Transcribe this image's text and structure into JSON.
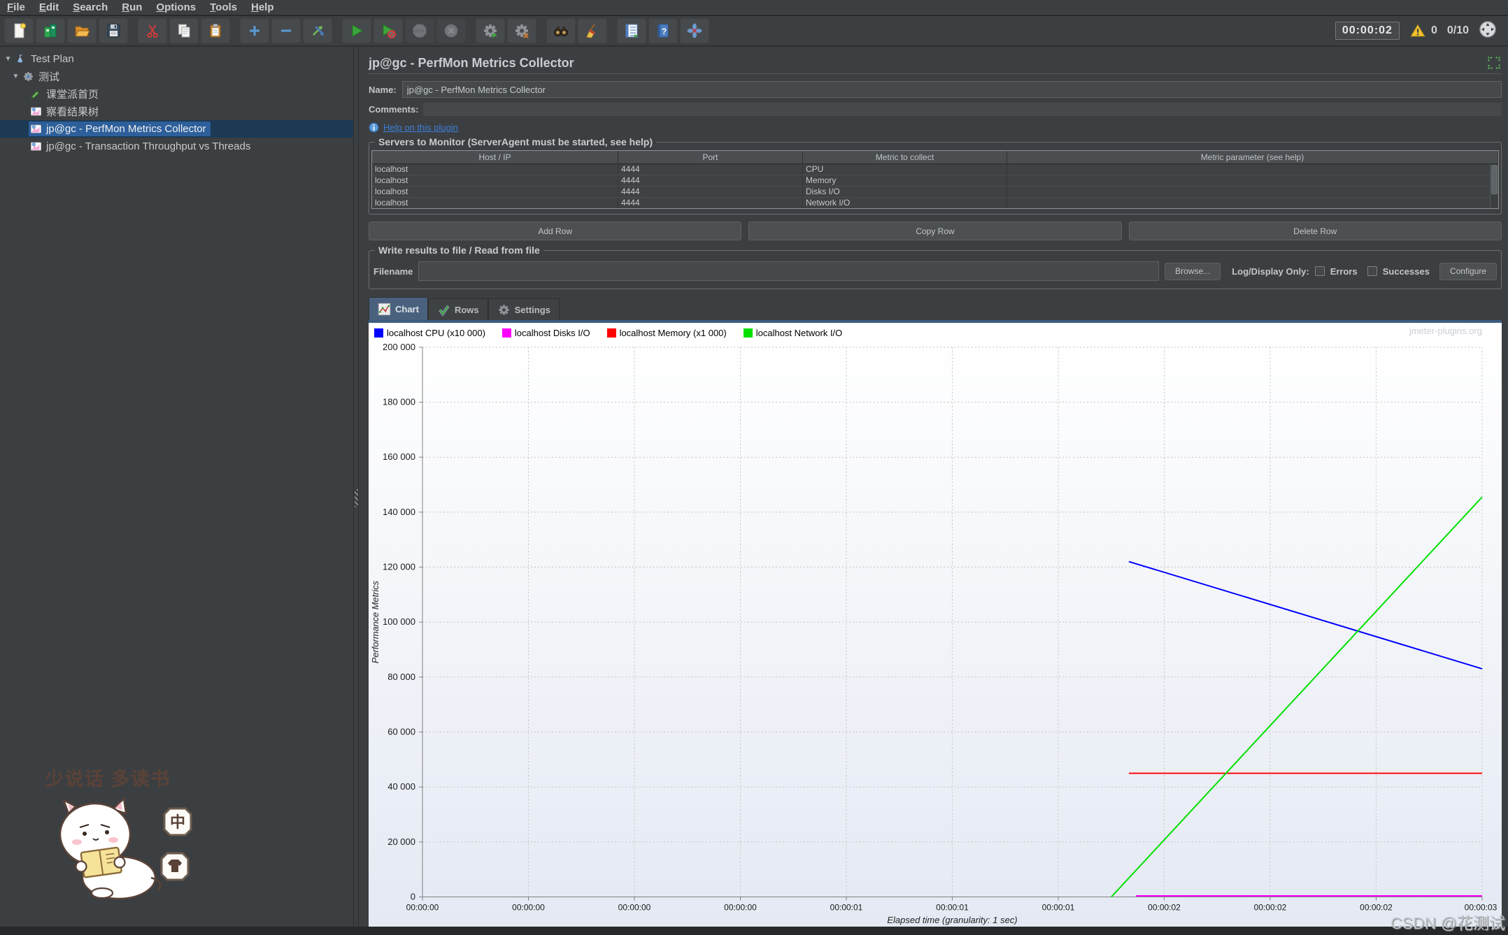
{
  "colors": {
    "window_bg": "#3C3F41",
    "selection_blue": "#2D5F9B",
    "link_blue": "#3D7EDB",
    "series_blue": "#0000FF",
    "series_magenta": "#FF00FF",
    "series_red": "#FF0000",
    "series_green": "#00E000"
  },
  "menu": {
    "items": [
      "File",
      "Edit",
      "Search",
      "Run",
      "Options",
      "Tools",
      "Help"
    ]
  },
  "toolbar": {
    "buttons": [
      {
        "name": "new-file",
        "disabled": false
      },
      {
        "name": "templates",
        "disabled": false
      },
      {
        "name": "open",
        "disabled": false
      },
      {
        "name": "save",
        "disabled": false
      },
      {
        "name": "cut",
        "disabled": false,
        "group": true
      },
      {
        "name": "copy",
        "disabled": false
      },
      {
        "name": "paste",
        "disabled": false
      },
      {
        "name": "expand-add",
        "disabled": false,
        "group": true
      },
      {
        "name": "collapse-remove",
        "disabled": false
      },
      {
        "name": "toggle",
        "disabled": false
      },
      {
        "name": "start",
        "disabled": false,
        "group": true
      },
      {
        "name": "start-no-pauses",
        "disabled": false
      },
      {
        "name": "stop",
        "disabled": true
      },
      {
        "name": "shutdown",
        "disabled": true
      },
      {
        "name": "remote-start-all",
        "disabled": false,
        "group": true
      },
      {
        "name": "remote-stop-all",
        "disabled": false
      },
      {
        "name": "search",
        "disabled": false,
        "group": true
      },
      {
        "name": "clear-all",
        "disabled": false
      },
      {
        "name": "function-helper",
        "disabled": false,
        "group": true
      },
      {
        "name": "help",
        "disabled": false
      },
      {
        "name": "plugins-manager",
        "disabled": false
      }
    ],
    "timer": "00:00:02",
    "warning_count": "0",
    "thread_count": "0/10"
  },
  "tree": {
    "items": [
      {
        "label": "Test Plan",
        "icon": "testplan-beaker-icon",
        "level": 0,
        "expander": true,
        "selected": false
      },
      {
        "label": "测试",
        "icon": "threadgroup-gear-icon",
        "level": 1,
        "expander": true,
        "selected": false
      },
      {
        "label": "课堂派首页",
        "icon": "http-sampler-pen-icon",
        "level": 2,
        "expander": false,
        "selected": false
      },
      {
        "label": "察看结果树",
        "icon": "listener-chart-icon",
        "level": 2,
        "expander": false,
        "selected": false
      },
      {
        "label": "jp@gc - PerfMon Metrics Collector",
        "icon": "listener-chart-icon",
        "level": 2,
        "expander": false,
        "selected": true
      },
      {
        "label": "jp@gc - Transaction Throughput vs Threads",
        "icon": "listener-chart-icon",
        "level": 2,
        "expander": false,
        "selected": false
      }
    ]
  },
  "sticker": {
    "caption": "少说话  多读书",
    "badge1": "中"
  },
  "panel": {
    "title": "jp@gc - PerfMon Metrics Collector",
    "name_label": "Name:",
    "name_value": "jp@gc - PerfMon Metrics Collector",
    "comments_label": "Comments:",
    "comments_value": "",
    "help_link": "Help on this plugin",
    "servers_group_title": "Servers to Monitor (ServerAgent must be started, see help)",
    "table": {
      "headers": [
        "Host / IP",
        "Port",
        "Metric to collect",
        "Metric parameter (see help)"
      ],
      "rows": [
        [
          "localhost",
          "4444",
          "CPU",
          ""
        ],
        [
          "localhost",
          "4444",
          "Memory",
          ""
        ],
        [
          "localhost",
          "4444",
          "Disks I/O",
          ""
        ],
        [
          "localhost",
          "4444",
          "Network I/O",
          ""
        ]
      ]
    },
    "buttons": {
      "add": "Add Row",
      "copy": "Copy Row",
      "delete": "Delete Row"
    },
    "file_group_title": "Write results to file / Read from file",
    "filename_label": "Filename",
    "filename_value": "",
    "browse_label": "Browse...",
    "log_display_label": "Log/Display Only:",
    "errors_label": "Errors",
    "successes_label": "Successes",
    "configure_label": "Configure",
    "tabs": [
      {
        "label": "Chart",
        "icon": "chart-tab-icon",
        "selected": true
      },
      {
        "label": "Rows",
        "icon": "rows-check-icon",
        "selected": false
      },
      {
        "label": "Settings",
        "icon": "settings-gear-icon",
        "selected": false
      }
    ],
    "watermark": "jmeter-plugins.org"
  },
  "chart_data": {
    "type": "line",
    "title": "",
    "xlabel": "Elapsed time (granularity: 1 sec)",
    "ylabel": "Performance Metrics",
    "xlim": [
      0,
      3
    ],
    "ylim": [
      0,
      200000
    ],
    "grid": true,
    "legend_position": "top-left",
    "x_ticks": [
      {
        "x": 0.0,
        "label": "00:00:00"
      },
      {
        "x": 0.3,
        "label": "00:00:00"
      },
      {
        "x": 0.6,
        "label": "00:00:00"
      },
      {
        "x": 0.9,
        "label": "00:00:00"
      },
      {
        "x": 1.2,
        "label": "00:00:01"
      },
      {
        "x": 1.5,
        "label": "00:00:01"
      },
      {
        "x": 1.8,
        "label": "00:00:01"
      },
      {
        "x": 2.1,
        "label": "00:00:02"
      },
      {
        "x": 2.4,
        "label": "00:00:02"
      },
      {
        "x": 2.7,
        "label": "00:00:02"
      },
      {
        "x": 3.0,
        "label": "00:00:03"
      }
    ],
    "y_ticks": [
      {
        "y": 0,
        "label": "0"
      },
      {
        "y": 20000,
        "label": "20 000"
      },
      {
        "y": 40000,
        "label": "40 000"
      },
      {
        "y": 60000,
        "label": "60 000"
      },
      {
        "y": 80000,
        "label": "80 000"
      },
      {
        "y": 100000,
        "label": "100 000"
      },
      {
        "y": 120000,
        "label": "120 000"
      },
      {
        "y": 140000,
        "label": "140 000"
      },
      {
        "y": 160000,
        "label": "160 000"
      },
      {
        "y": 180000,
        "label": "180 000"
      },
      {
        "y": 200000,
        "label": "200 000"
      }
    ],
    "series": [
      {
        "name": "localhost CPU (x10 000)",
        "color": "#0000FF",
        "points": [
          [
            2.0,
            122000
          ],
          [
            3.0,
            83000
          ]
        ]
      },
      {
        "name": "localhost Disks I/O",
        "color": "#FF00FF",
        "points": [
          [
            2.02,
            400
          ],
          [
            3.0,
            400
          ]
        ]
      },
      {
        "name": "localhost Memory (x1 000)",
        "color": "#FF0000",
        "points": [
          [
            2.0,
            45000
          ],
          [
            3.0,
            45000
          ]
        ]
      },
      {
        "name": "localhost Network I/O",
        "color": "#00E000",
        "points": [
          [
            1.95,
            0
          ],
          [
            3.0,
            145500
          ]
        ]
      }
    ]
  },
  "footer": {
    "csdn_watermark": "CSDN @花测试"
  }
}
